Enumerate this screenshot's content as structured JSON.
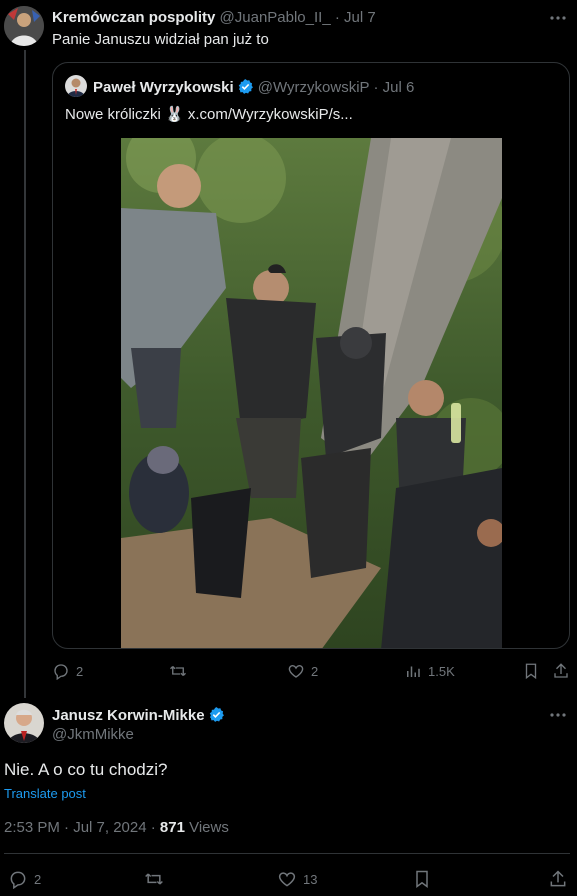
{
  "reply_tweet": {
    "display_name": "Kremówczan pospolity",
    "handle": "@JuanPablo_II_",
    "date": "· Jul 7",
    "text": "Panie Januszu widział pan już to",
    "actions": {
      "replies": "2",
      "retweets": "",
      "likes": "2",
      "views": "1.5K"
    }
  },
  "quoted_tweet": {
    "display_name": "Paweł Wyrzykowski",
    "handle": "@WyrzykowskiP",
    "date": "· Jul 6",
    "text_prefix": "Nowe króliczki",
    "emoji": "🐰",
    "link": "x.com/WyrzykowskiP/s..."
  },
  "main_tweet": {
    "display_name": "Janusz Korwin-Mikke",
    "handle": "@JkmMikke",
    "text": "Nie. A o co tu chodzi?",
    "translate_label": "Translate post",
    "timestamp": "2:53 PM · Jul 7, 2024 · ",
    "views_count": "871",
    "views_label": " Views",
    "actions": {
      "replies": "2",
      "retweets": "",
      "likes": "13"
    }
  },
  "colors": {
    "accent": "#1d9bf0",
    "verified": "#1d9bf0",
    "muted": "#71767b",
    "divider": "#2f3336"
  }
}
